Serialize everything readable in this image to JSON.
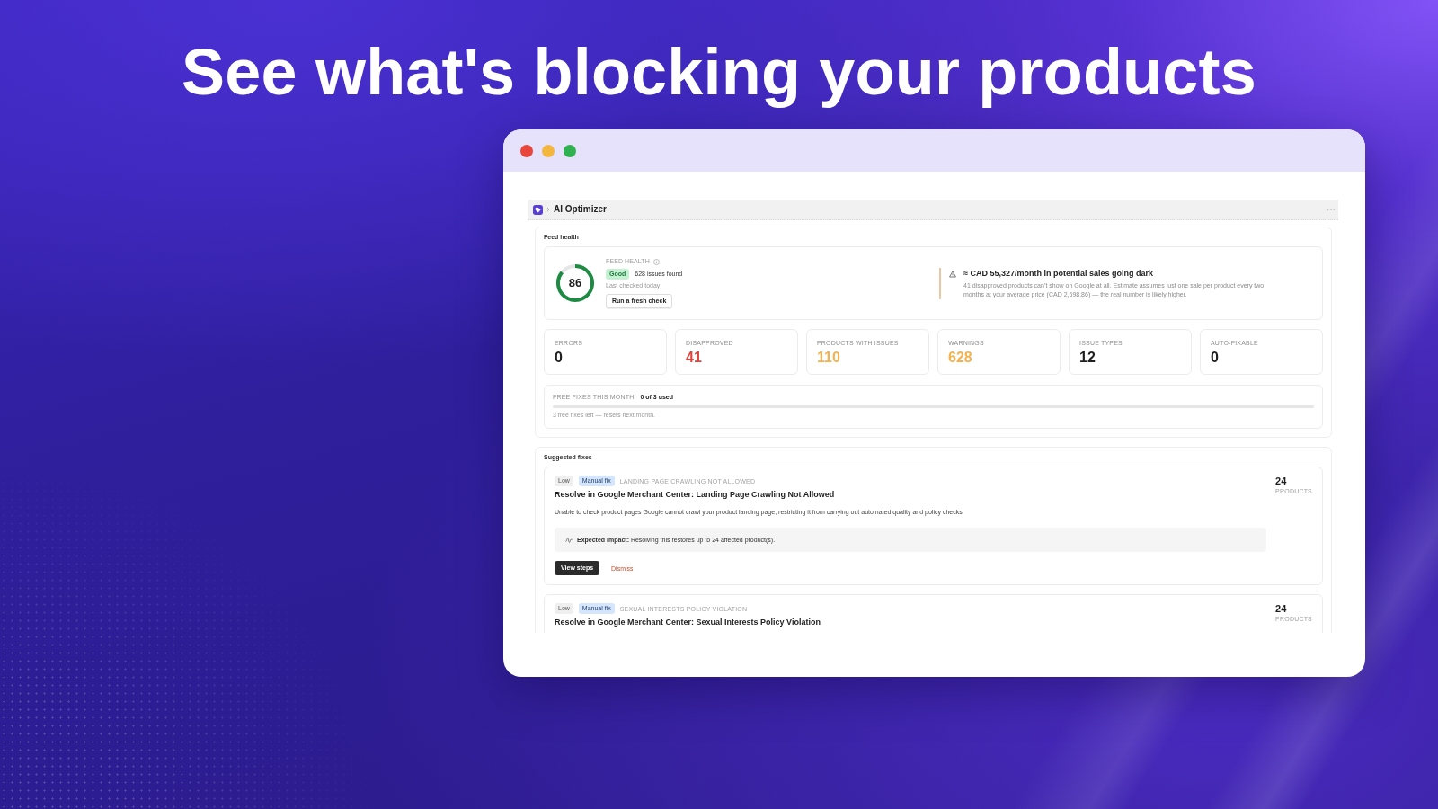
{
  "headline": "See what's blocking your products",
  "app_bar": {
    "title": "AI Optimizer"
  },
  "feed_health": {
    "heading": "Feed health",
    "score": "86",
    "level": 0.86,
    "label": "FEED HEALTH",
    "status": "Good",
    "issues": "628 issues found",
    "last_checked": "Last checked today",
    "action": "Run a fresh check",
    "alert": {
      "title": "≈ CAD 55,327/month in potential sales going dark",
      "text": "41 disapproved products can’t show on Google at all. Estimate assumes just one sale per product every two months at your average price (CAD 2,698.86) — the real number is likely higher."
    }
  },
  "stats": [
    {
      "label": "ERRORS",
      "value": "0",
      "color": "#1f1f1f"
    },
    {
      "label": "DISAPPROVED",
      "value": "41",
      "color": "#e0443a"
    },
    {
      "label": "PRODUCTS WITH ISSUES",
      "value": "110",
      "color": "#f5b14c"
    },
    {
      "label": "WARNINGS",
      "value": "628",
      "color": "#f5b14c"
    },
    {
      "label": "ISSUE TYPES",
      "value": "12",
      "color": "#1f1f1f"
    },
    {
      "label": "AUTO-FIXABLE",
      "value": "0",
      "color": "#1f1f1f"
    }
  ],
  "free_fixes": {
    "label": "FREE FIXES THIS MONTH",
    "usage": "0 of 3 used",
    "level": 0,
    "note": "3 free fixes left — resets next month."
  },
  "suggested_fixes": {
    "heading": "Suggested fixes",
    "items": [
      {
        "priority": "Low",
        "fix_type": "Manual fix",
        "category": "LANDING PAGE CRAWLING NOT ALLOWED",
        "title": "Resolve in Google Merchant Center: Landing Page Crawling Not Allowed",
        "description": "Unable to check product pages Google cannot crawl your product landing page, restricting it from carrying out automated quality and policy checks",
        "impact": "**Expected impact:** Resolving this restores up to 24 affected product(s).",
        "count": "24",
        "count_label": "PRODUCTS",
        "actions": [
          {
            "label": "View steps",
            "kind": "primary"
          },
          {
            "label": "Dismiss",
            "kind": "link"
          }
        ]
      },
      {
        "priority": "Low",
        "fix_type": "Manual fix",
        "category": "SEXUAL INTERESTS POLICY VIOLATION",
        "title": "Resolve in Google Merchant Center: Sexual Interests Policy Violation",
        "count": "24",
        "count_label": "PRODUCTS"
      }
    ]
  }
}
